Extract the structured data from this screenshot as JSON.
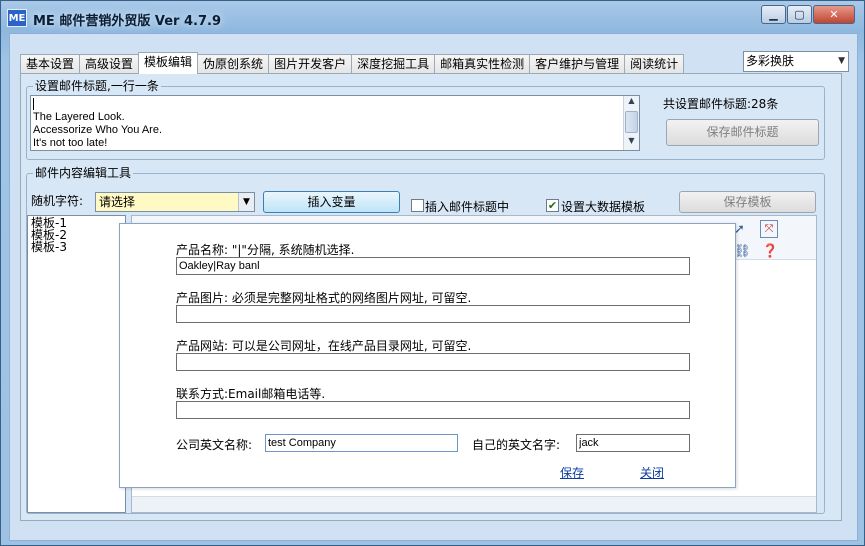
{
  "window": {
    "app_icon": "ME",
    "title": "ME 邮件营销外贸版 Ver 4.7.9",
    "min_icon": "minimize-icon",
    "max_icon": "maximize-icon",
    "close_icon": "close-icon"
  },
  "tabs": [
    {
      "label": "基本设置",
      "active": false
    },
    {
      "label": "高级设置",
      "active": false
    },
    {
      "label": "模板编辑",
      "active": true
    },
    {
      "label": "伪原创系统",
      "active": false
    },
    {
      "label": "图片开发客户",
      "active": false
    },
    {
      "label": "深度挖掘工具",
      "active": false
    },
    {
      "label": "邮箱真实性检测",
      "active": false
    },
    {
      "label": "客户维护与管理",
      "active": false
    },
    {
      "label": "阅读统计",
      "active": false
    }
  ],
  "skin_select": {
    "value": "多彩换肤"
  },
  "subjects_group": {
    "title": "设置邮件标题,一行一条",
    "lines": [
      "The Layered Look.",
      "Accessorize Who You Are.",
      "It's not too late!"
    ],
    "count_label": "共设置邮件标题:28条",
    "save_label": "保存邮件标题"
  },
  "content_group": {
    "title": "邮件内容编辑工具",
    "random_label": "随机字符:",
    "random_select": "请选择",
    "insert_variable_label": "插入变量",
    "insert_into_subject_label": "插入邮件标题中",
    "insert_into_subject_checked": false,
    "bigdata_label": "设置大数据模板",
    "bigdata_checked": true,
    "save_template_label": "保存模板",
    "templates": [
      "模板-1",
      "模板-2",
      "模板-3"
    ]
  },
  "dialog": {
    "product_name_label": "产品名称: \"|\"分隔, 系统随机选择.",
    "product_name_value": "Oakley|Ray banl",
    "product_image_label": "产品图片: 必须是完整网址格式的网络图片网址, 可留空.",
    "product_image_value": "",
    "product_site_label": "产品网站: 可以是公司网址，在线产品目录网址, 可留空.",
    "product_site_value": "",
    "contact_label": "联系方式:Email邮箱电话等.",
    "contact_value": "",
    "company_label": "公司英文名称:",
    "company_value": "test Company",
    "myname_label": "自己的英文名字:",
    "myname_value": "jack",
    "save_link": "保存",
    "close_link": "关闭"
  }
}
